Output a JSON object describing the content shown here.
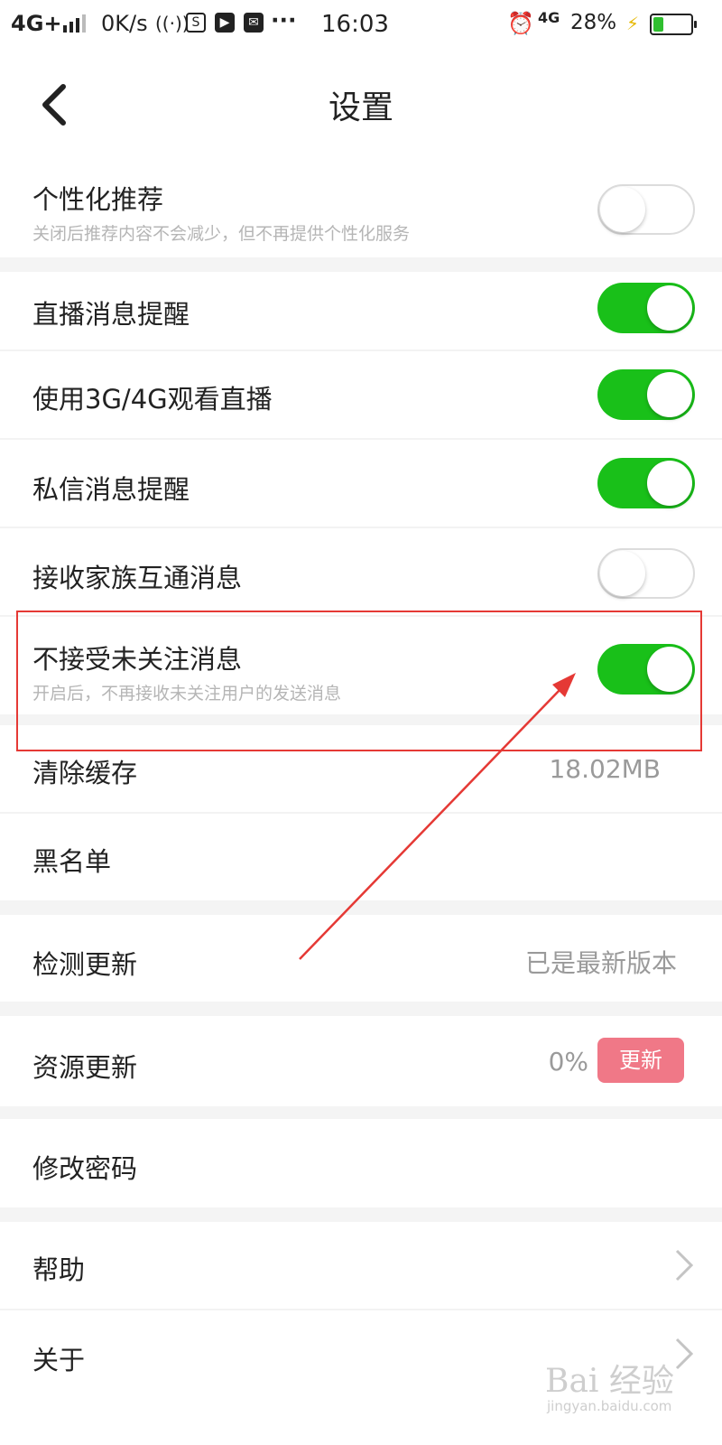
{
  "status_bar": {
    "network": "4G+",
    "speed": "0K/s",
    "time": "16:03",
    "network_right": "4G",
    "battery_percent": "28%",
    "battery_level": 0.28,
    "icons": [
      "signal-icon",
      "hotspot-icon",
      "app-icon-s",
      "play-icon",
      "mail-icon",
      "more-icon",
      "alarm-icon",
      "charging-icon",
      "battery-icon"
    ]
  },
  "header": {
    "title": "设置",
    "back_icon": "back-arrow-icon"
  },
  "settings": [
    {
      "label": "个性化推荐",
      "sub": "关闭后推荐内容不会减少，但不再提供个性化服务",
      "toggle": false
    },
    {
      "label": "直播消息提醒",
      "toggle": true
    },
    {
      "label": "使用3G/4G观看直播",
      "toggle": true
    },
    {
      "label": "私信消息提醒",
      "toggle": true
    },
    {
      "label": "接收家族互通消息",
      "toggle": false
    },
    {
      "label": "不接受未关注消息",
      "sub": "开启后，不再接收未关注用户的发送消息",
      "toggle": true
    },
    {
      "label": "清除缓存",
      "value": "18.02MB"
    },
    {
      "label": "黑名单"
    },
    {
      "label": "检测更新",
      "value": "已是最新版本"
    },
    {
      "label": "资源更新",
      "value": "0%",
      "button": "更新"
    },
    {
      "label": "修改密码"
    },
    {
      "label": "帮助",
      "icon": "chevron-right-icon"
    },
    {
      "label": "关于",
      "icon": "chevron-right-icon"
    }
  ],
  "colors": {
    "toggle_on": "#19c019",
    "toggle_off_border": "#dcdcdc",
    "update_button": "#f07887",
    "annotation": "#e53935"
  },
  "watermark": {
    "main": "Bai 经验",
    "sub": "jingyan.baidu.com"
  }
}
